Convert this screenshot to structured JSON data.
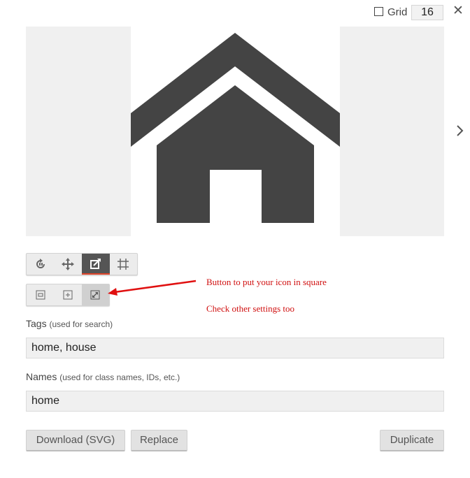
{
  "grid": {
    "label": "Grid",
    "value": "16",
    "checked": false
  },
  "preview": {
    "icon": "home-icon",
    "icon_color": "#444444"
  },
  "toolbar_transform": [
    {
      "icon": "rotate-icon",
      "active": false
    },
    {
      "icon": "move-icon",
      "active": false
    },
    {
      "icon": "resize-square-icon",
      "active": true
    },
    {
      "icon": "crop-icon",
      "active": false
    }
  ],
  "toolbar_fit": [
    {
      "icon": "fit-inner-icon",
      "active": false
    },
    {
      "icon": "fit-plus-icon",
      "active": false
    },
    {
      "icon": "expand-icon",
      "active": true
    }
  ],
  "annotations": {
    "line1": "Button to put your icon in square",
    "line2": "Check other settings too",
    "color": "#d01010"
  },
  "tags": {
    "label": "Tags",
    "hint": "(used for search)",
    "value": "home, house"
  },
  "names": {
    "label": "Names",
    "hint": "(used for class names, IDs, etc.)",
    "value": "home"
  },
  "buttons": {
    "download": "Download (SVG)",
    "replace": "Replace",
    "duplicate": "Duplicate"
  }
}
